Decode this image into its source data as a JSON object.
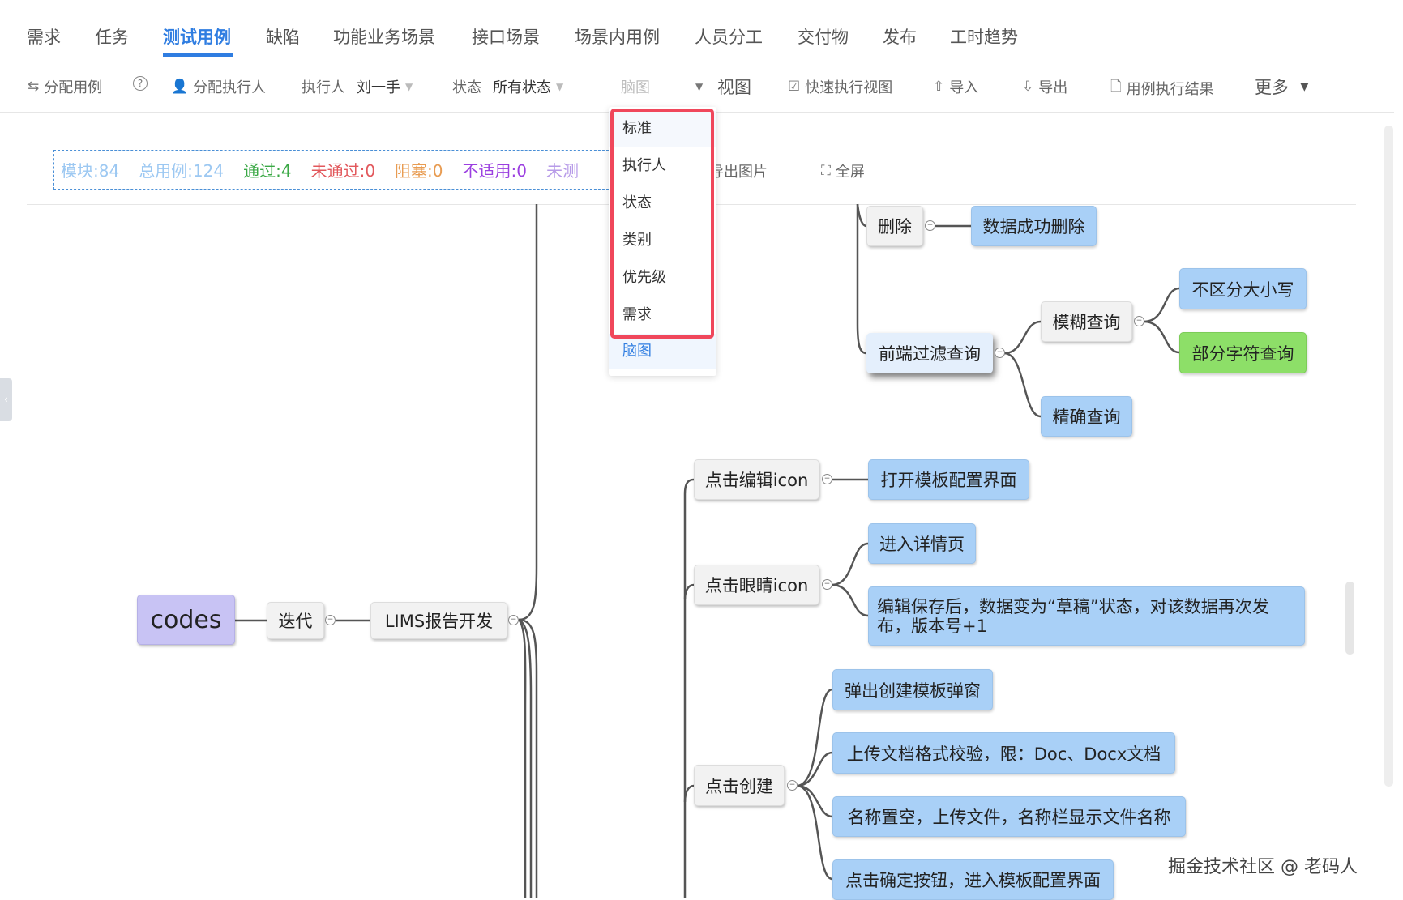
{
  "tabs": [
    "需求",
    "任务",
    "测试用例",
    "缺陷",
    "功能业务场景",
    "接口场景",
    "场景内用例",
    "人员分工",
    "交付物",
    "发布",
    "工时趋势"
  ],
  "active_tab": "测试用例",
  "toolbar": {
    "assign_cases": "分配用例",
    "help_icon": "?",
    "assign_executor": "分配执行人",
    "executor_label": "执行人",
    "executor_value": "刘一手",
    "status_label": "状态",
    "status_value": "所有状态",
    "view_select_value": "脑图",
    "view_label": "视图",
    "quick_exec_view": "快速执行视图",
    "import": "导入",
    "export": "导出",
    "exec_results": "用例执行结果",
    "more": "更多"
  },
  "stats": {
    "modules": "模块:84",
    "total": "总用例:124",
    "passed": "通过:4",
    "failed": "未通过:0",
    "blocked": "阻塞:0",
    "na": "不适用:0",
    "untested": "未测"
  },
  "stats_colors": {
    "modules": "#9cc8f2",
    "total": "#9cc8f2",
    "passed": "#3aa845",
    "failed": "#e2585c",
    "blocked": "#e89c52",
    "na": "#9b3fe0",
    "untested": "#b79be8"
  },
  "canvas_actions": {
    "export_image": "导出图片",
    "fullscreen": "全屏"
  },
  "view_dropdown": {
    "options": [
      "标准",
      "执行人",
      "状态",
      "类别",
      "优先级",
      "需求",
      "脑图"
    ],
    "selected": "脑图"
  },
  "mindmap": {
    "root": "codes",
    "iteration": "迭代",
    "project": "LIMS报告开发",
    "delete": "删除",
    "delete_result": "数据成功删除",
    "frontend_filter": "前端过滤查询",
    "fuzzy": "模糊查询",
    "case_insensitive": "不区分大小写",
    "partial": "部分字符查询",
    "exact": "精确查询",
    "edit_icon": "点击编辑icon",
    "open_config": "打开模板配置界面",
    "eye_icon": "点击眼睛icon",
    "detail": "进入详情页",
    "edit_save_line1": "编辑保存后，数据变为“草稿”状态，对该数据再次发",
    "edit_save_line2": "布，版本号+1",
    "create": "点击创建",
    "popup": "弹出创建模板弹窗",
    "upload": "上传文档格式校验，限：Doc、Docx文档",
    "name_empty": "名称置空，上传文件，名称栏显示文件名称",
    "confirm": "点击确定按钮，进入模板配置界面"
  },
  "watermark": "掘金技术社区 @ 老码人"
}
